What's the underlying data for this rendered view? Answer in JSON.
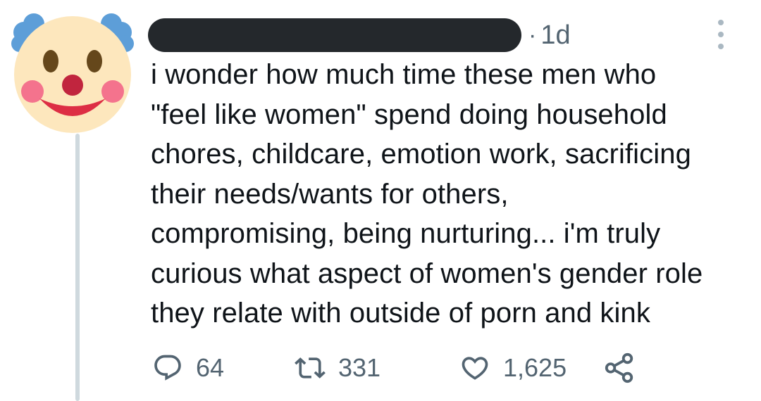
{
  "tweet": {
    "author_redacted": true,
    "timestamp_separator": "·",
    "timestamp": "1d",
    "text": "i wonder how much time these men who\n\"feel like women\" spend doing household\nchores, childcare, emotion work, sacrificing\ntheir needs/wants for others,\ncompromising, being nurturing... i'm truly\ncurious what aspect of women's gender role\nthey relate with outside of porn and kink"
  },
  "avatar": {
    "icon": "clown-face-icon"
  },
  "actions": {
    "reply_count": "64",
    "retweet_count": "331",
    "like_count": "1,625"
  },
  "colors": {
    "text": "#0f1419",
    "muted": "#536471",
    "thread_line": "#cfd9de",
    "redaction": "#24282c"
  }
}
